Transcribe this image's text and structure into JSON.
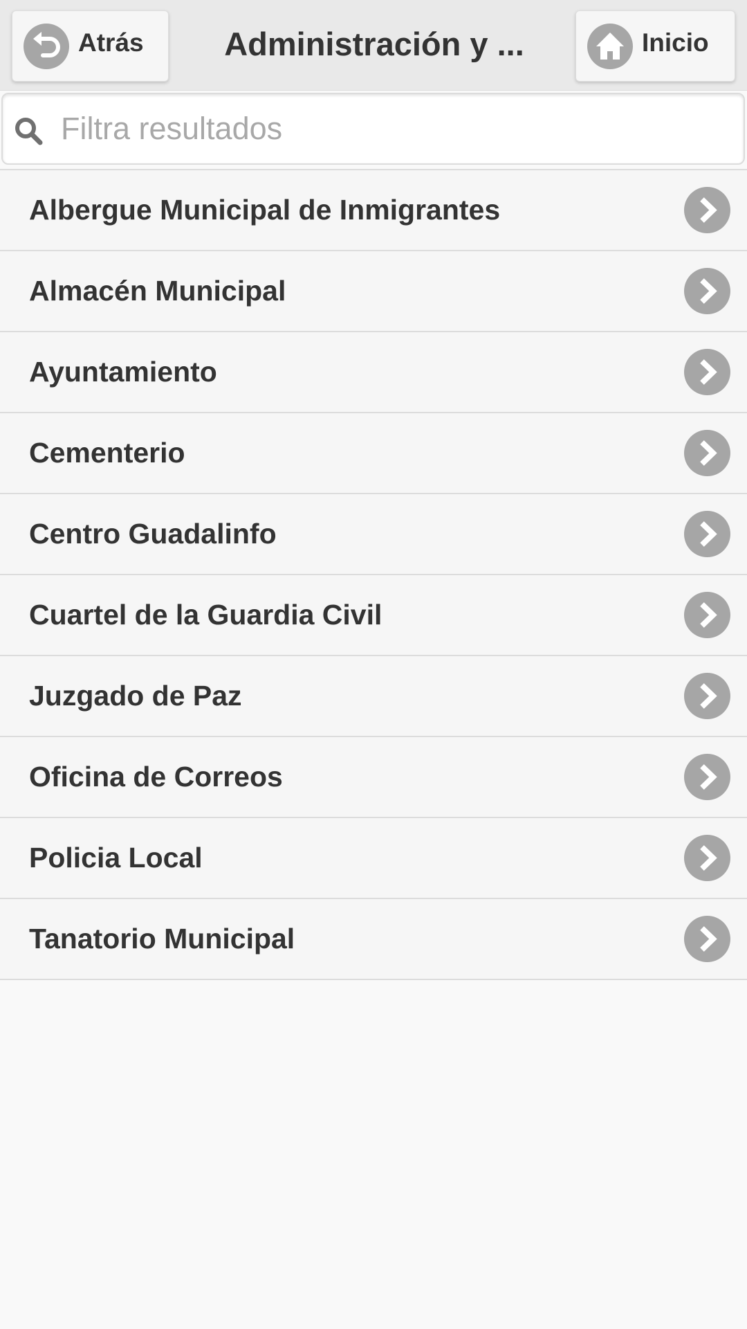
{
  "header": {
    "title": "Administración y ...",
    "back_label": "Atrás",
    "home_label": "Inicio"
  },
  "search": {
    "placeholder": "Filtra resultados",
    "value": ""
  },
  "list": {
    "items": [
      {
        "label": "Albergue Municipal de Inmigrantes"
      },
      {
        "label": "Almacén Municipal"
      },
      {
        "label": "Ayuntamiento"
      },
      {
        "label": "Cementerio"
      },
      {
        "label": "Centro Guadalinfo"
      },
      {
        "label": "Cuartel de la Guardia Civil"
      },
      {
        "label": "Juzgado de Paz"
      },
      {
        "label": "Oficina de Correos"
      },
      {
        "label": "Policia Local"
      },
      {
        "label": "Tanatorio Municipal"
      }
    ]
  },
  "icons": {
    "back": "undo-arrow-icon",
    "home": "home-icon",
    "search": "search-icon",
    "item": "chevron-right-icon"
  },
  "colors": {
    "header_bg": "#e9e9e9",
    "icon_circle": "#a6a6a6",
    "text": "#333333",
    "placeholder": "#a8a8a8",
    "row_bg": "#f6f6f6",
    "divider": "#dcdcdc"
  }
}
